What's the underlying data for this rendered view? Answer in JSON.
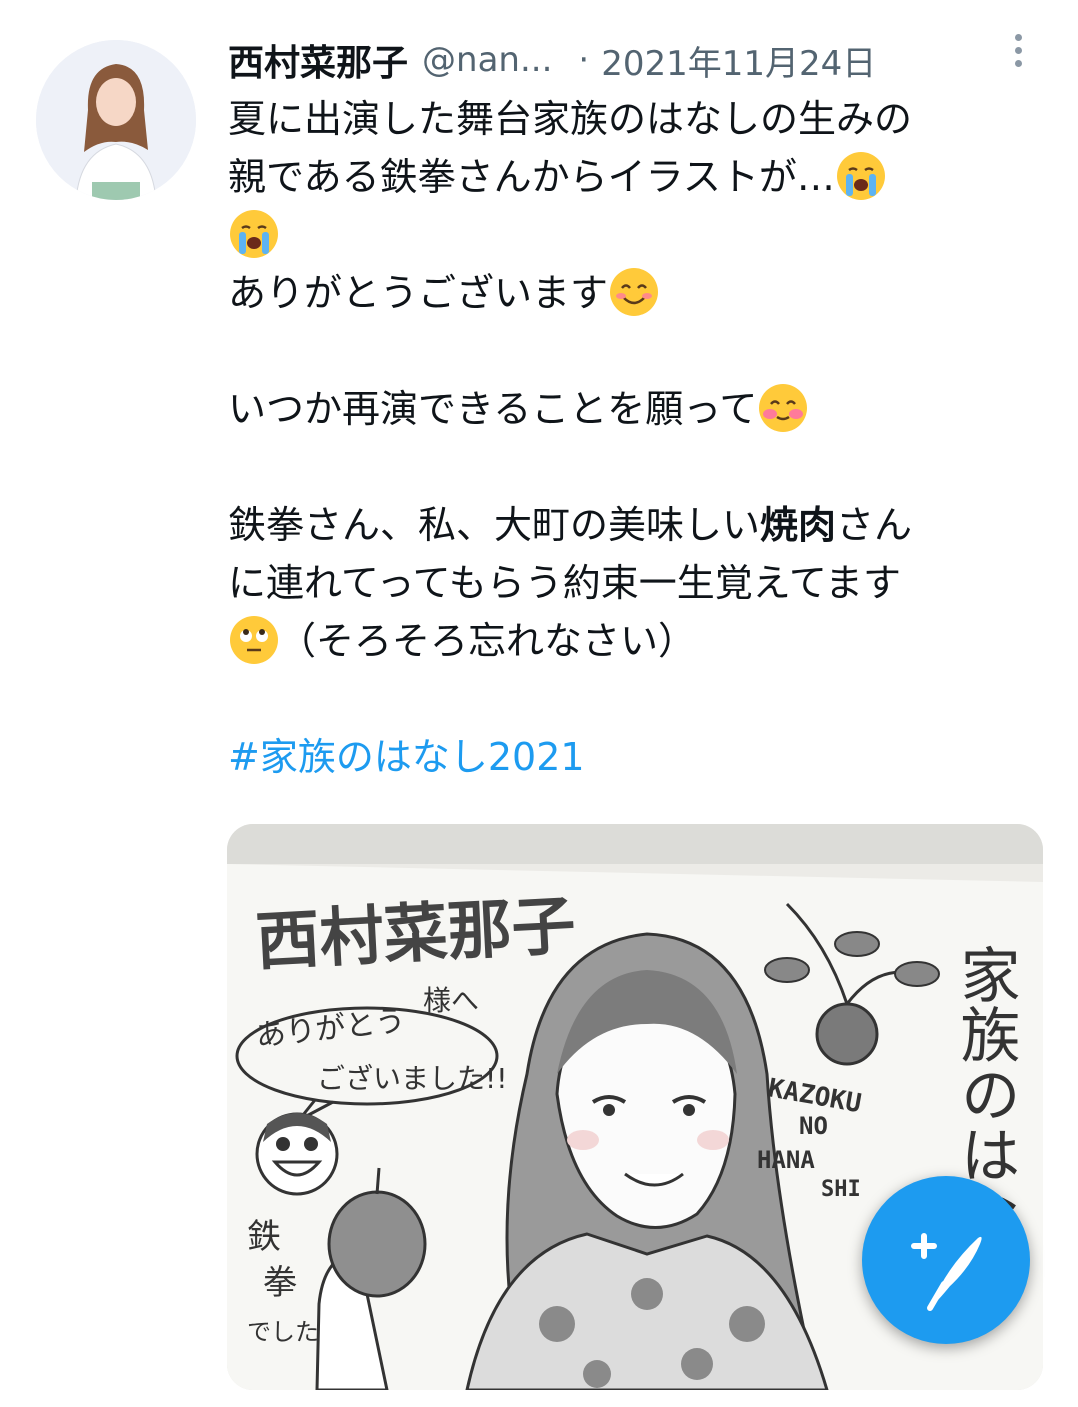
{
  "tweet": {
    "author_name": "西村菜那子",
    "handle": "@nan...",
    "separator": "·",
    "date": "2021年11月24日",
    "line1": "夏に出演した舞台家族のはなしの生みの",
    "line2": "親である鉄拳さんからイラストが…",
    "line4": "ありがとうございます",
    "line6": "いつか再演できることを願って",
    "line8_a": "鉄拳さん、私、大町の美味しい",
    "line8_bold": "焼肉",
    "line8_b": "さん",
    "line9": "に連れてってもらう約束一生覚えてます",
    "line10": "（そろそろ忘れなさい）",
    "hashtag": "#家族のはなし2021"
  },
  "illustration": {
    "title": "西村菜那子",
    "honorific": "様へ",
    "speech1": "ありがとう",
    "speech2": "ございました!!",
    "signature1": "鉄",
    "signature2": "拳",
    "signature3": "でした",
    "romaji1": "KAZOKU",
    "romaji2": "NO",
    "romaji3": "HANA",
    "romaji4": "SHI",
    "vertical_title": "家族のはな"
  },
  "colors": {
    "link": "#1d9bf0",
    "fab": "#1d9bf0",
    "secondary_text": "#536471"
  }
}
